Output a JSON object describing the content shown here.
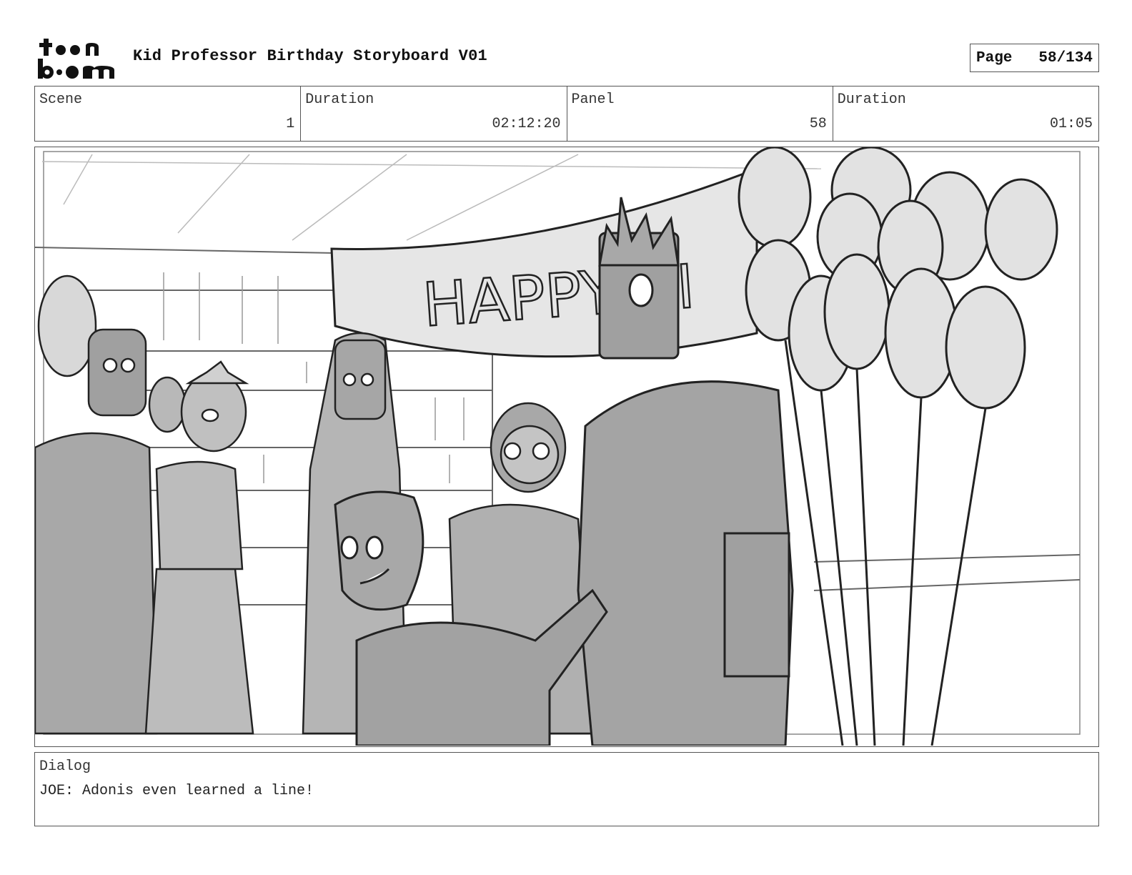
{
  "header": {
    "logo_text": "toon boom",
    "title": "Kid Professor Birthday Storyboard V01",
    "page_label": "Page",
    "page_value": "58/134"
  },
  "info": [
    {
      "label": "Scene",
      "value": "1"
    },
    {
      "label": "Duration",
      "value": "02:12:20"
    },
    {
      "label": "Panel",
      "value": "58"
    },
    {
      "label": "Duration",
      "value": "01:05"
    }
  ],
  "panel": {
    "banner_text": "HAPPY BI"
  },
  "dialog": {
    "label": "Dialog",
    "text": "JOE: Adonis even learned a line!"
  }
}
